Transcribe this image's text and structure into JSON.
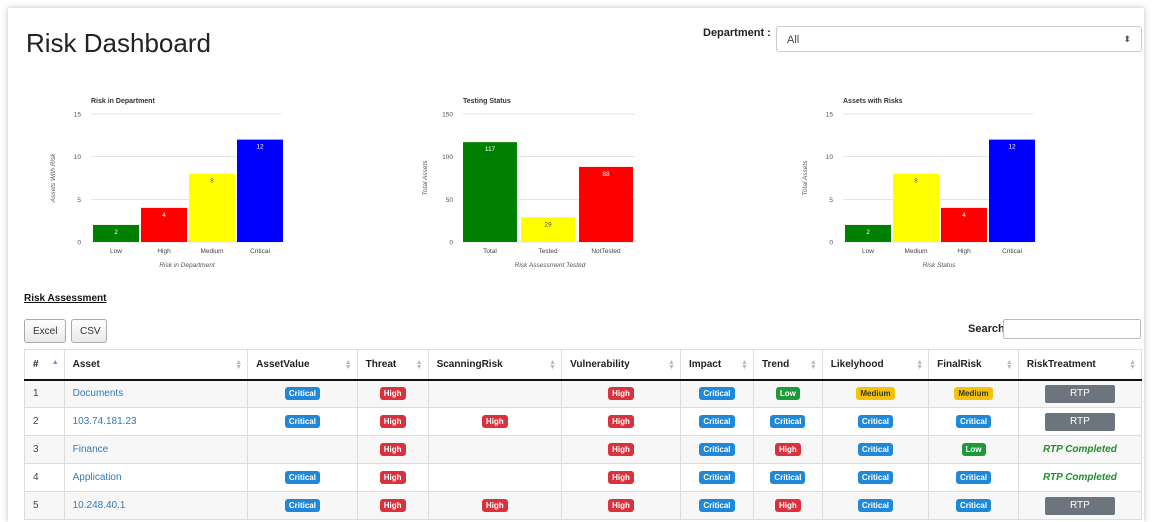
{
  "page_title": "Risk Dashboard",
  "department": {
    "label": "Department :",
    "value": "All"
  },
  "chart_data": [
    {
      "type": "bar",
      "title": "Risk in Department",
      "xlabel": "Risk in Department",
      "ylabel": "Assets With Risk",
      "categories": [
        "Low",
        "High",
        "Medium",
        "Critical"
      ],
      "values": [
        2,
        4,
        8,
        12
      ],
      "colors": [
        "#008000",
        "#ff0000",
        "#ffff00",
        "#0000ff"
      ],
      "ylim": [
        0,
        15
      ],
      "yticks": [
        0,
        5,
        10,
        15
      ]
    },
    {
      "type": "bar",
      "title": "Testing Status",
      "xlabel": "Risk Assessment Tested",
      "ylabel": "Total Assets",
      "categories": [
        "Total",
        "Tested",
        "NotTested"
      ],
      "values": [
        117,
        29,
        88
      ],
      "colors": [
        "#008000",
        "#ffff00",
        "#ff0000"
      ],
      "ylim": [
        0,
        150
      ],
      "yticks": [
        0,
        50,
        100,
        150
      ]
    },
    {
      "type": "bar",
      "title": "Assets with Risks",
      "xlabel": "Risk Status",
      "ylabel": "Total Assets",
      "categories": [
        "Low",
        "Medium",
        "High",
        "Critical"
      ],
      "values": [
        2,
        8,
        4,
        12
      ],
      "colors": [
        "#008000",
        "#ffff00",
        "#ff0000",
        "#0000ff"
      ],
      "ylim": [
        0,
        15
      ],
      "yticks": [
        0,
        5,
        10,
        15
      ]
    }
  ],
  "section_title": "Risk Assessment",
  "buttons": {
    "excel": "Excel",
    "csv": "CSV"
  },
  "search_label": "Search:",
  "table": {
    "headers": [
      "#",
      "Asset",
      "AssetValue",
      "Threat",
      "ScanningRisk",
      "Vulnerability",
      "Impact",
      "Trend",
      "Likelyhood",
      "FinalRisk",
      "RiskTreatment"
    ],
    "rows": [
      {
        "num": "1",
        "asset": "Documents",
        "asset_value": "Critical",
        "threat": "High",
        "scanning": "",
        "vulnerability": "High",
        "impact": "Critical",
        "trend": "Low",
        "likelyhood": "Medium",
        "final": "Medium",
        "treatment": "RTP"
      },
      {
        "num": "2",
        "asset": "103.74.181.23",
        "asset_value": "Critical",
        "threat": "High",
        "scanning": "High",
        "vulnerability": "High",
        "impact": "Critical",
        "trend": "Critical",
        "likelyhood": "Critical",
        "final": "Critical",
        "treatment": "RTP"
      },
      {
        "num": "3",
        "asset": "Finance",
        "asset_value": "",
        "threat": "High",
        "scanning": "",
        "vulnerability": "High",
        "impact": "Critical",
        "trend": "High",
        "likelyhood": "Critical",
        "final": "Low",
        "treatment": "RTP Completed"
      },
      {
        "num": "4",
        "asset": "Application",
        "asset_value": "Critical",
        "threat": "High",
        "scanning": "",
        "vulnerability": "High",
        "impact": "Critical",
        "trend": "Critical",
        "likelyhood": "Critical",
        "final": "Critical",
        "treatment": "RTP Completed"
      },
      {
        "num": "5",
        "asset": "10.248.40.1",
        "asset_value": "Critical",
        "threat": "High",
        "scanning": "High",
        "vulnerability": "High",
        "impact": "Critical",
        "trend": "High",
        "likelyhood": "Critical",
        "final": "Critical",
        "treatment": "RTP"
      }
    ]
  }
}
